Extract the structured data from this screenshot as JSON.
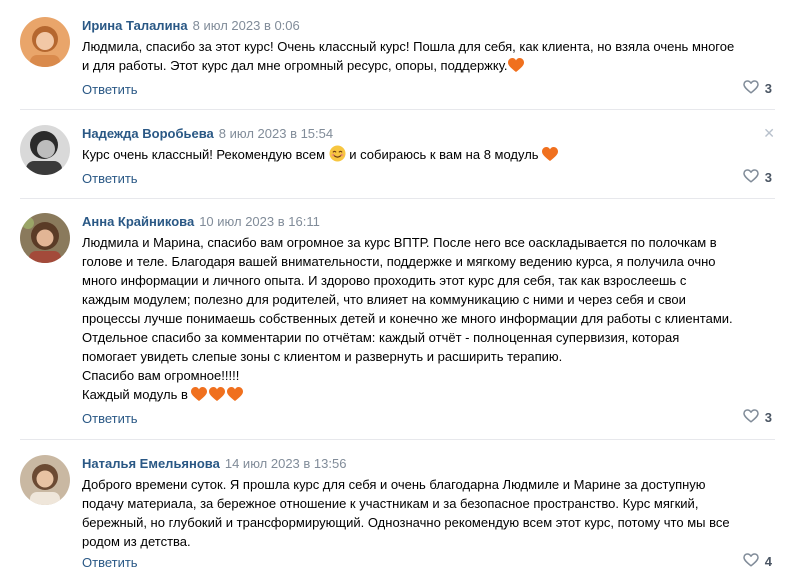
{
  "comments": [
    {
      "author": "Ирина Талалина",
      "date": "8 июл 2023 в 0:06",
      "lines": [
        "Людмила, спасибо за этот курс! Очень классный курс! Пошла для себя, как клиента, но взяла очень многое",
        "и для работы. Этот курс дал мне огромный ресурс, опоры, поддержку."
      ],
      "reply_label": "Ответить",
      "likes": "3"
    },
    {
      "author": "Надежда Воробьева",
      "date": "8 июл 2023 в 15:54",
      "line_a": "Курс очень классный! Рекомендую всем ",
      "line_b": " и собираюсь к вам на 8 модуль ",
      "reply_label": "Ответить",
      "likes": "3",
      "close_glyph": "✕"
    },
    {
      "author": "Анна Крайникова",
      "date": "10 июл 2023 в 16:11",
      "lines": [
        "Людмила и Марина, спасибо вам огромное за курс ВПТР. После него все оаскладывается по полочкам в",
        "голове и теле. Благодаря вашей внимательности, поддержке и мягкому ведению курса, я получила очно",
        "много информации и личного опыта. И здорово проходить этот курс для себя, так как взрослеешь с",
        "каждым модулем; полезно для родителей, что влияет на коммуникацию с ними и через себя и свои",
        "процессы лучше понимаешь собственных детей и конечно же много информации для работы с клиентами.",
        "Отдельное спасибо за комментарии по отчётам: каждый отчёт - полноценная супервизия, которая",
        "помогает увидеть слепые зоны с клиентом и развернуть и расширить терапию.",
        "Спасибо вам огромное!!!!!",
        "Каждый модуль в "
      ],
      "reply_label": "Ответить",
      "likes": "3"
    },
    {
      "author": "Наталья Емельянова",
      "date": "14 июл 2023 в 13:56",
      "lines": [
        "Доброго времени суток. Я прошла курс для себя и очень благодарна Людмиле и Марине за доступную",
        "подачу материала, за бережное отношение к участникам и за безопасное пространство. Курс мягкий,",
        "бережный, но глубокий и трансформирующий. Однозначно рекомендую всем этот курс, потому что мы все",
        "родом из детства."
      ],
      "reply_label": "Ответить",
      "likes": "4"
    }
  ],
  "colors": {
    "author": "#2a5885",
    "date": "#818c99",
    "link": "#2a5885",
    "divider": "#e7e8ec",
    "heart_emoji": "#f0701e"
  },
  "icons": {
    "like": "heart-outline-icon",
    "emoji_heart": "orange-heart-emoji",
    "emoji_smile": "smiling-face-emoji"
  }
}
